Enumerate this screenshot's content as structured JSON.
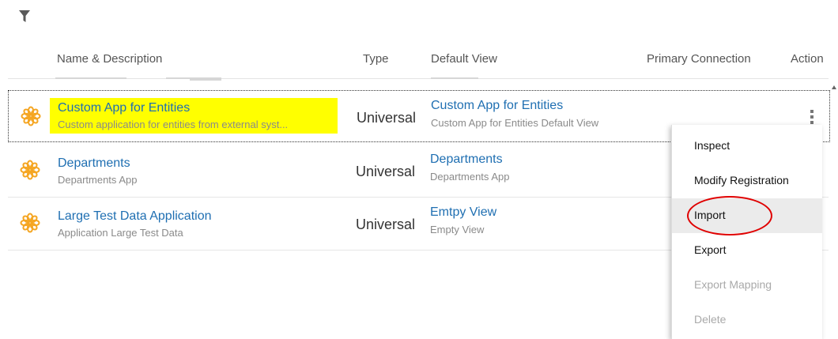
{
  "toolbar": {
    "filter_icon": "filter-icon"
  },
  "columns": {
    "name": "Name & Description",
    "type": "Type",
    "default_view": "Default View",
    "primary_connection": "Primary Connection",
    "action": "Action"
  },
  "rows": [
    {
      "name": "Custom App for Entities",
      "description": "Custom application for entities from external syst...",
      "type": "Universal",
      "view_name": "Custom App for Entities",
      "view_description": "Custom App for Entities Default View",
      "primary_connection": ""
    },
    {
      "name": "Departments",
      "description": "Departments App",
      "type": "Universal",
      "view_name": "Departments",
      "view_description": "Departments App",
      "primary_connection": ""
    },
    {
      "name": "Large Test Data Application",
      "description": "Application Large Test Data",
      "type": "Universal",
      "view_name": "Emtpy View",
      "view_description": "Empty View",
      "primary_connection": ""
    }
  ],
  "context_menu": {
    "items": [
      {
        "label": "Inspect",
        "enabled": true
      },
      {
        "label": "Modify Registration",
        "enabled": true
      },
      {
        "label": "Import",
        "enabled": true,
        "hovered": true,
        "annotated": true
      },
      {
        "label": "Export",
        "enabled": true
      },
      {
        "label": "Export Mapping",
        "enabled": false
      },
      {
        "label": "Delete",
        "enabled": false
      }
    ]
  },
  "colors": {
    "link": "#1f6fb2",
    "highlight": "#ffff00",
    "icon": "#f5a623",
    "annotation": "#e00000"
  }
}
